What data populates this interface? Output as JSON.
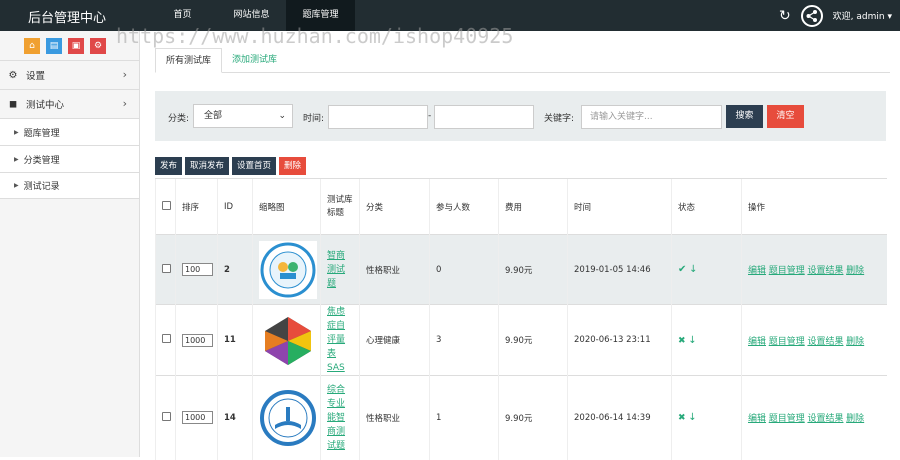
{
  "app": {
    "title": "后台管理中心"
  },
  "nav": [
    {
      "label": "首页"
    },
    {
      "label": "网站信息"
    },
    {
      "label": "题库管理"
    }
  ],
  "user": {
    "welcome": "欢迎, admin"
  },
  "watermark": "https://www.huzhan.com/ishop40925",
  "sidebar": {
    "items": [
      {
        "label": "设置",
        "icon": "gears-icon"
      },
      {
        "label": "测试中心",
        "icon": "book-icon"
      }
    ],
    "subitems": [
      {
        "label": "题库管理"
      },
      {
        "label": "分类管理"
      },
      {
        "label": "测试记录"
      }
    ]
  },
  "tabs": [
    {
      "label": "所有测试库"
    },
    {
      "label": "添加测试库"
    }
  ],
  "filter": {
    "category_label": "分类:",
    "category_value": "全部",
    "time_label": "时间:",
    "dash": "-",
    "keyword_label": "关键字:",
    "keyword_placeholder": "请输入关键字...",
    "search_label": "搜索",
    "clear_label": "清空"
  },
  "actions": {
    "publish": "发布",
    "unpublish": "取消发布",
    "set_home": "设置首页",
    "delete": "删除"
  },
  "table": {
    "headers": [
      "排序",
      "ID",
      "缩略图",
      "测试库标题",
      "分类",
      "参与人数",
      "费用",
      "时间",
      "状态",
      "操作"
    ],
    "rows": [
      {
        "sort": "100",
        "id": "2",
        "title": "智商测试题",
        "category": "性格职业",
        "participants": "0",
        "fee": "9.90元",
        "time": "2019-01-05 14:46"
      },
      {
        "sort": "1000",
        "id": "11",
        "title": "焦虑症自评量表SAS",
        "category": "心理健康",
        "participants": "3",
        "fee": "9.90元",
        "time": "2020-06-13 23:11"
      },
      {
        "sort": "1000",
        "id": "14",
        "title": "综合专业能智商测试题",
        "category": "性格职业",
        "participants": "1",
        "fee": "9.90元",
        "time": "2020-06-14 14:39"
      }
    ],
    "ops": {
      "edit": "编辑",
      "questions": "题目管理",
      "results": "设置结果",
      "delete": "删除"
    }
  }
}
